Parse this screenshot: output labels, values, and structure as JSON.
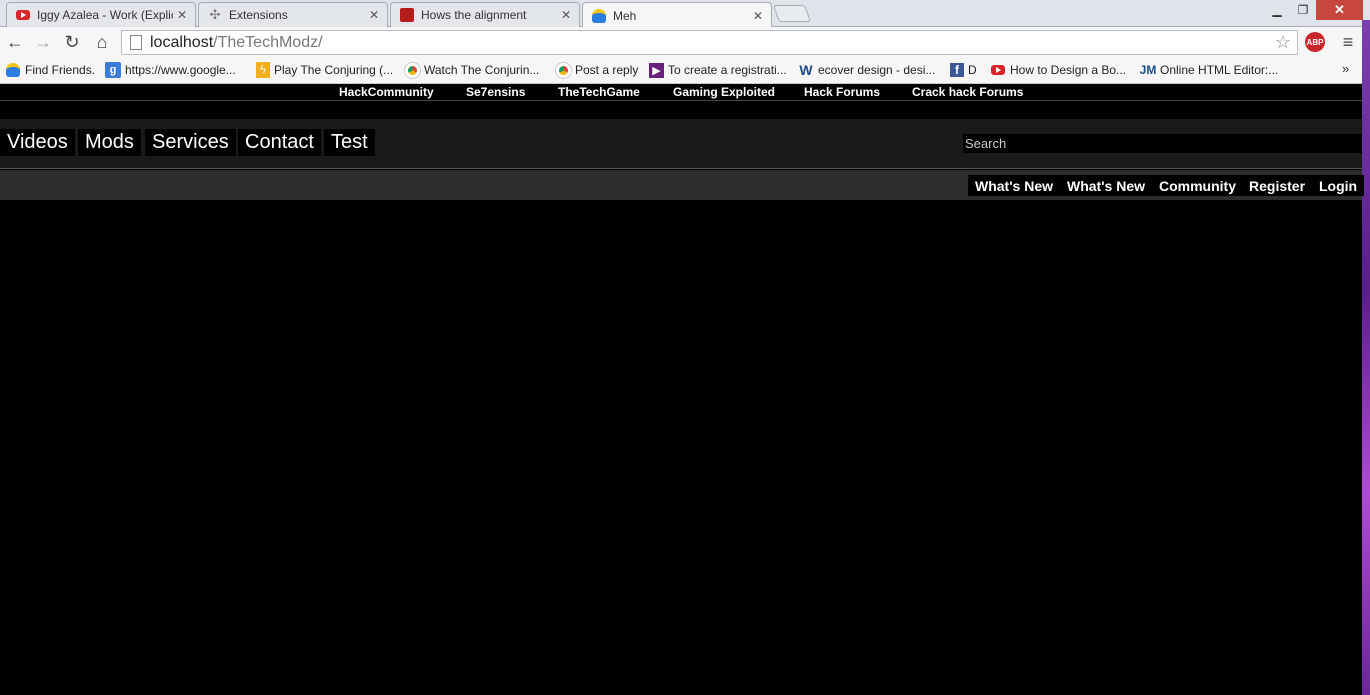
{
  "browser": {
    "tabs": [
      {
        "title": "Iggy Azalea - Work (Explic",
        "icon": "youtube-icon"
      },
      {
        "title": "Extensions",
        "icon": "puzzle-icon"
      },
      {
        "title": "Hows the alignment",
        "icon": "forum-icon"
      },
      {
        "title": "Meh",
        "icon": "person-icon"
      }
    ],
    "address": {
      "host": "localhost",
      "path": "/TheTechModz/"
    },
    "abp_label": "ABP",
    "bookmarks": [
      {
        "label": "Find Friends.",
        "icon": "person-icon"
      },
      {
        "label": "https://www.google...",
        "icon": "google-icon"
      },
      {
        "label": "Play The Conjuring (...",
        "icon": "bolt-icon"
      },
      {
        "label": "Watch The Conjurin...",
        "icon": "chrome-icon"
      },
      {
        "label": "Post a reply",
        "icon": "chrome-icon"
      },
      {
        "label": "To create a registrati...",
        "icon": "visualstudio-icon"
      },
      {
        "label": "ecover design - desi...",
        "icon": "wordpress-icon"
      },
      {
        "label": "D",
        "icon": "facebook-icon"
      },
      {
        "label": "How to Design a Bo...",
        "icon": "youtube-icon"
      },
      {
        "label": "Online HTML Editor:...",
        "icon": "jm-icon"
      }
    ],
    "bookmarks_more": "»"
  },
  "site": {
    "top_links": [
      "HackCommunity",
      "Se7ensins",
      "TheTechGame",
      "Gaming Exploited",
      "Hack Forums",
      "Crack hack Forums"
    ],
    "nav": [
      "Videos",
      "Mods",
      "Services",
      "Contact",
      "Test"
    ],
    "search_placeholder": "Search",
    "subnav": [
      "What's New",
      "What's New",
      "Community",
      "Register",
      "Login"
    ]
  },
  "colors": {
    "page_bg": "#000000",
    "navbar_bg": "#1a1a1a",
    "subbar_bg": "#2d2d2d",
    "text": "#ffffff"
  }
}
